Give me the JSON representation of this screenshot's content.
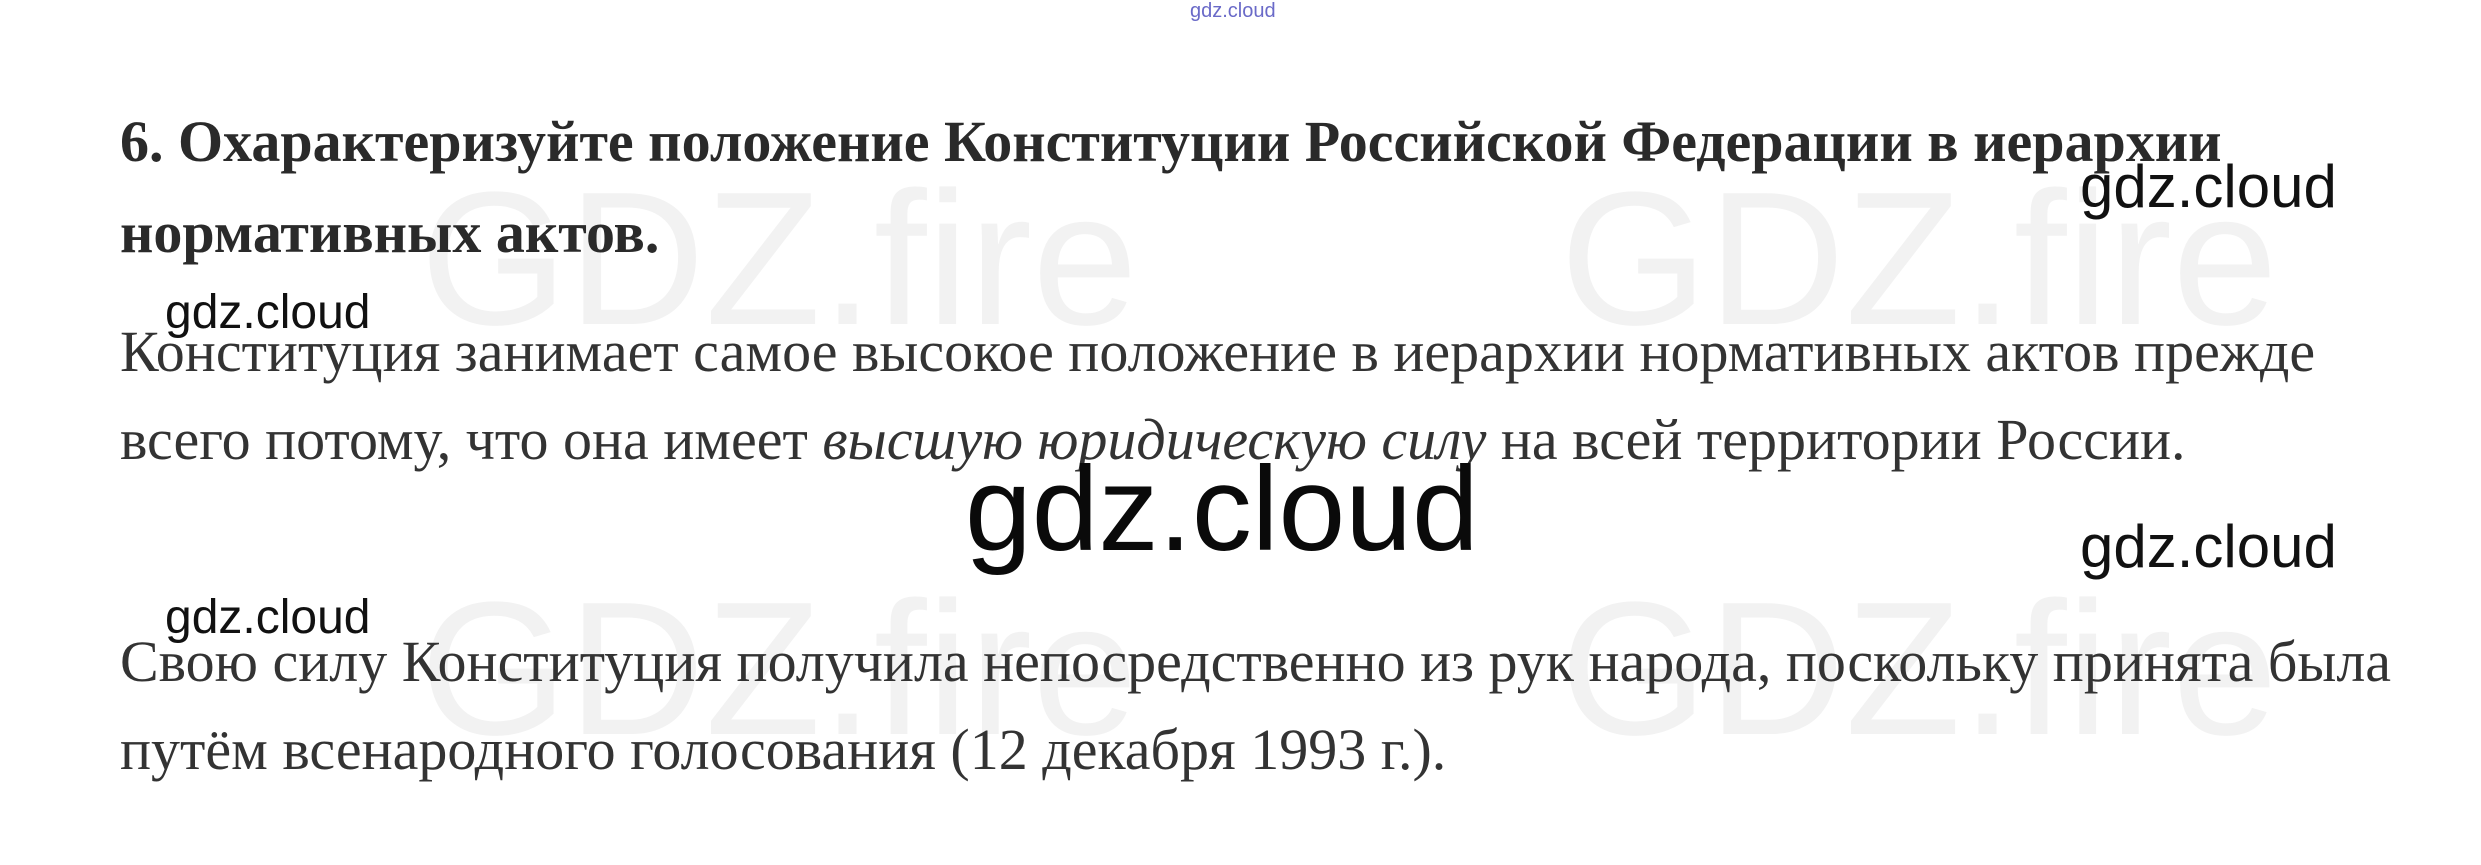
{
  "watermarks": {
    "top": "gdz.cloud",
    "right_1": "gdz.cloud",
    "right_2": "gdz.cloud",
    "left_1": "gdz.cloud",
    "left_2": "gdz.cloud",
    "center": "gdz.cloud",
    "faint": "GDZ.fire"
  },
  "question": {
    "text": "6. Охарактеризуйте положение Конституции Российской Федерации в иерархии нормативных актов."
  },
  "answer": {
    "p1_before": "Конституция занимает самое высокое положение в иерархии нормативных актов прежде всего потому, что она имеет ",
    "p1_italic": "высшую юридическую силу",
    "p1_after": " на всей территории России.",
    "p2": "Свою силу  Конституция получила непосредственно из рук народа, поскольку принята была путём всенародного голосования (12 декабря 1993 г.)."
  },
  "colors": {
    "text": "#333333",
    "heading": "#2a2a2a",
    "watermark": "#111111",
    "watermark_top": "#6a6ac8"
  }
}
